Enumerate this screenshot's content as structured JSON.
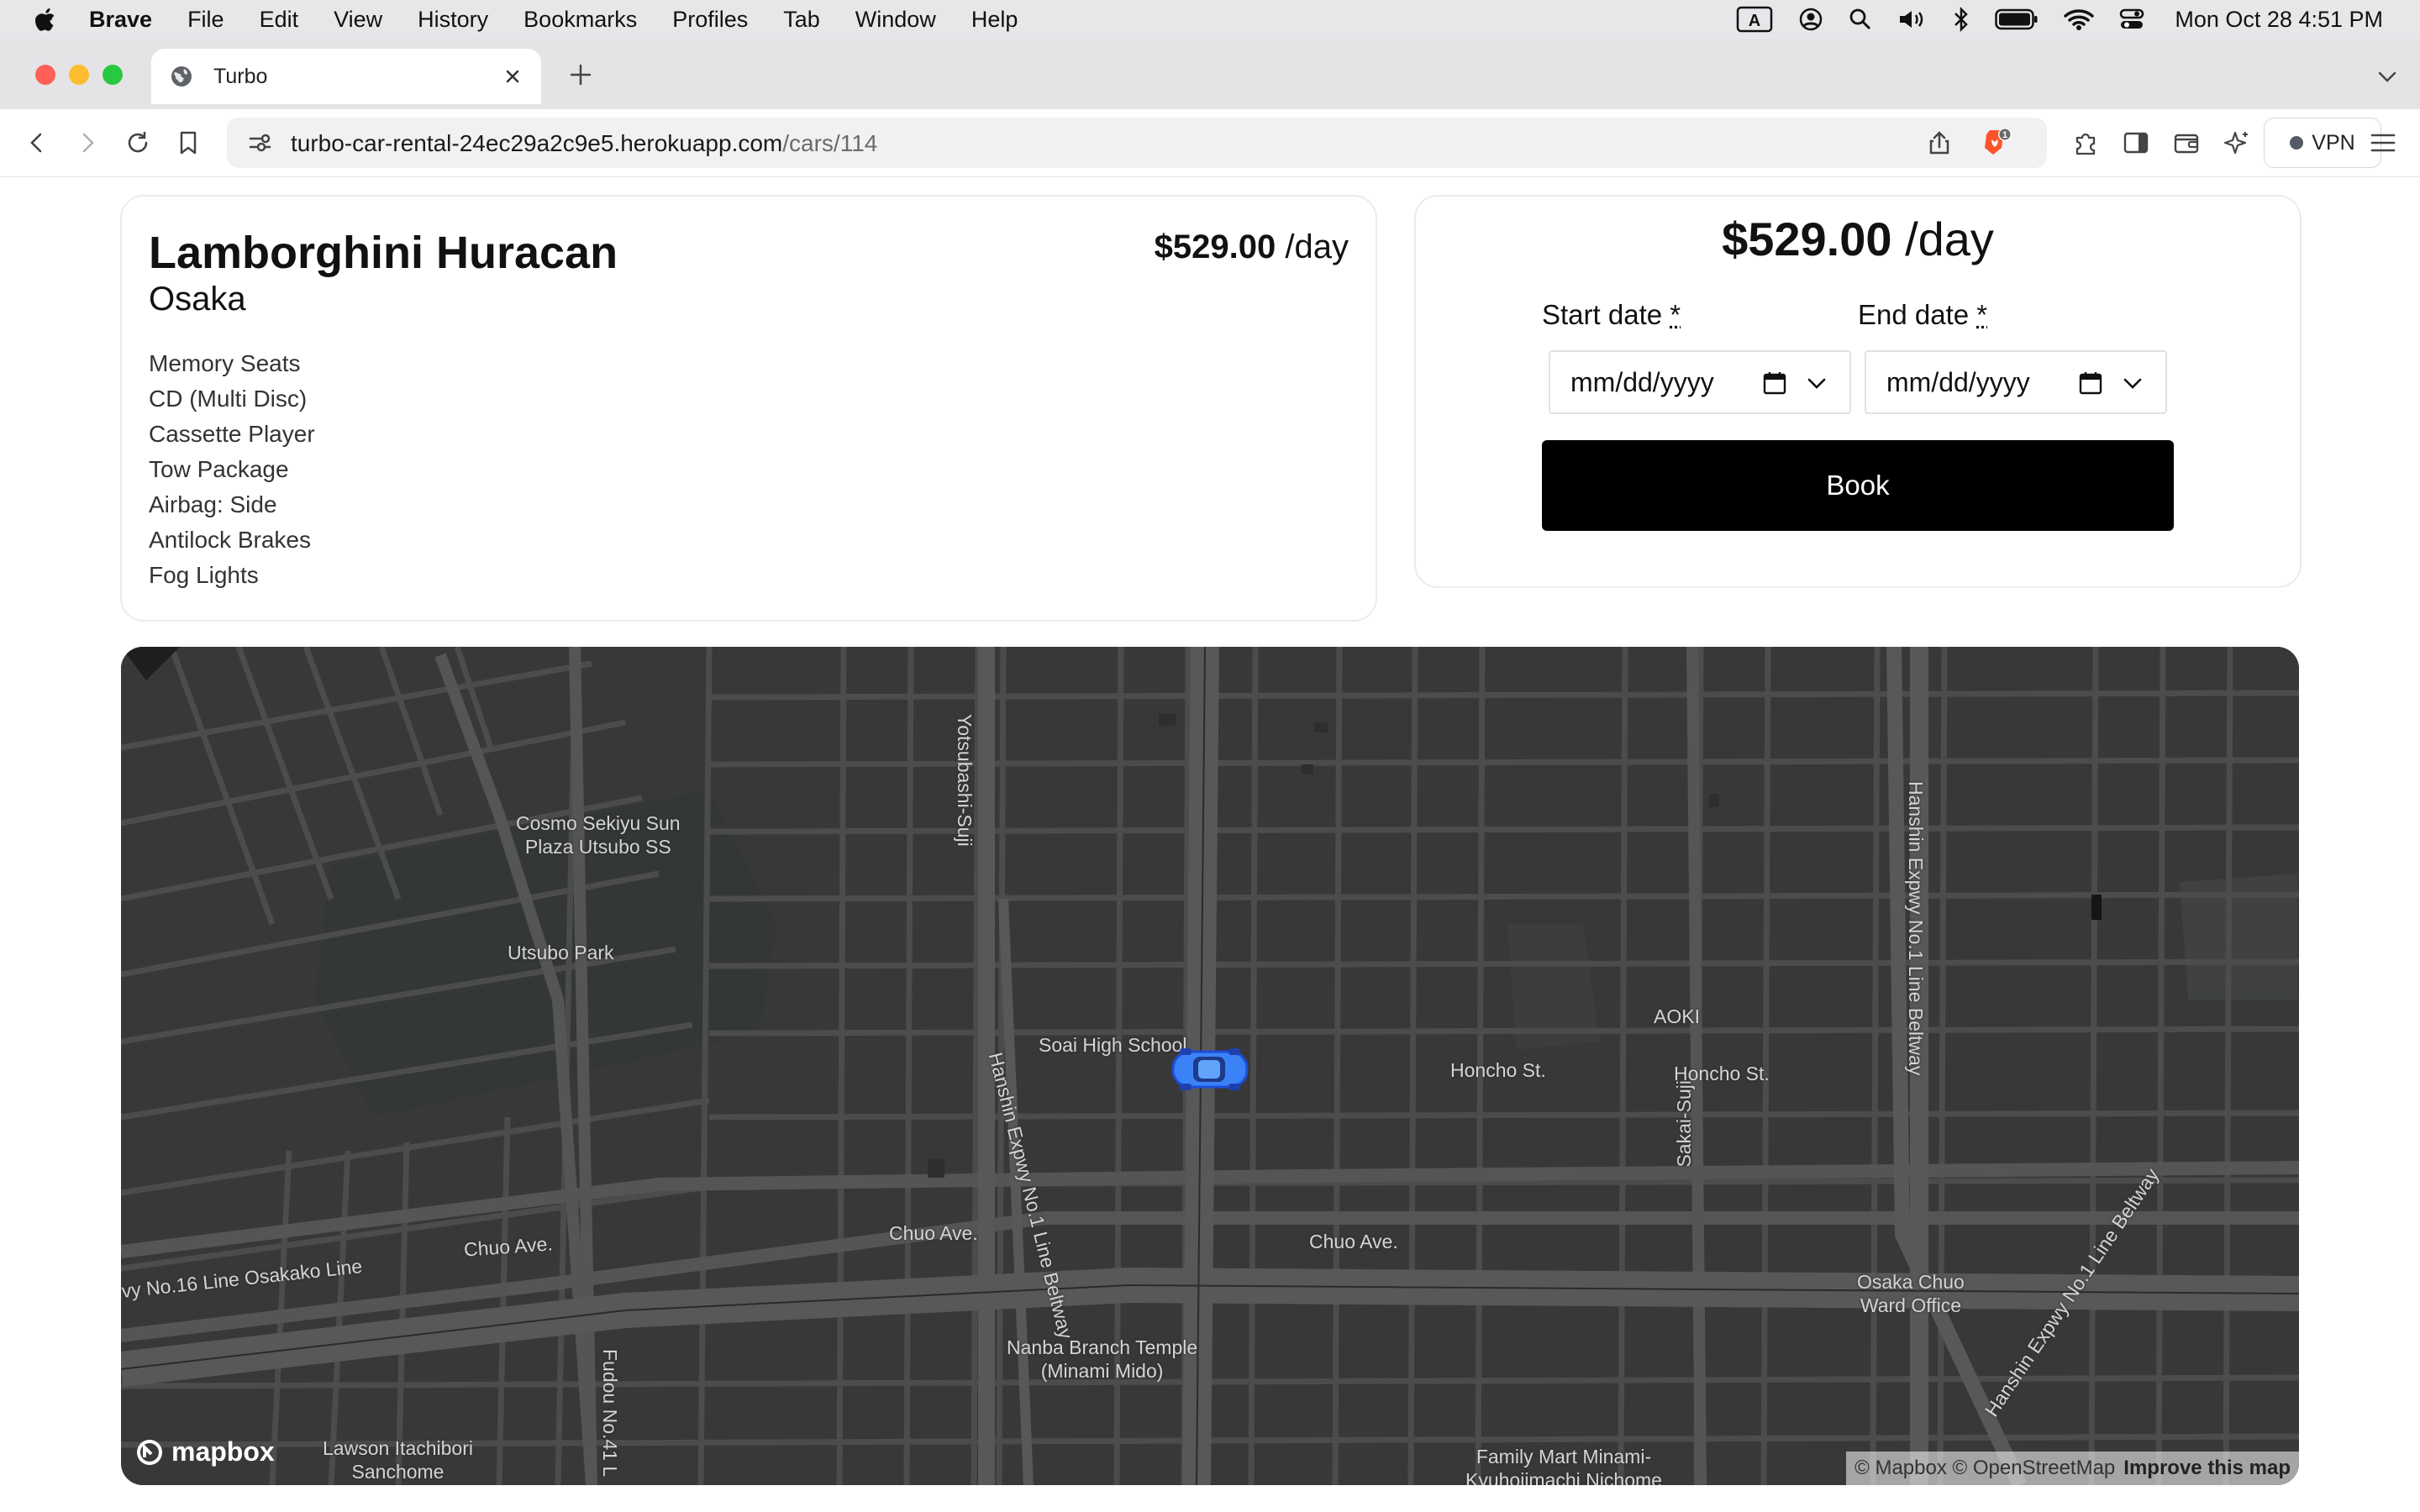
{
  "menubar": {
    "app_name": "Brave",
    "items": [
      "File",
      "Edit",
      "View",
      "History",
      "Bookmarks",
      "Profiles",
      "Tab",
      "Window",
      "Help"
    ],
    "input_source": "A",
    "clock": "Mon Oct 28  4:51 PM"
  },
  "browser": {
    "tab_title": "Turbo",
    "url_host": "turbo-car-rental-24ec29a2c9e5.herokuapp.com",
    "url_path": "/cars/114",
    "shield_count": "1",
    "vpn_label": "VPN",
    "colors": {
      "close": "#fe5f57",
      "minimize": "#febc2e",
      "zoom": "#28c840",
      "brave_orange": "#fb542b"
    }
  },
  "car": {
    "name": "Lamborghini Huracan",
    "city": "Osaka",
    "price": "$529.00",
    "per_day": "/day",
    "features": [
      "Memory Seats",
      "CD (Multi Disc)",
      "Cassette Player",
      "Tow Package",
      "Airbag: Side",
      "Antilock Brakes",
      "Fog Lights"
    ]
  },
  "booking": {
    "price": "$529.00",
    "per_day": "/day",
    "start_label": "Start date",
    "end_label": "End date",
    "required_mark": "*",
    "date_placeholder": "mm/dd/yyyy",
    "book_label": "Book"
  },
  "map": {
    "labels": {
      "cosmo": "Cosmo Sekiyu Sun\nPlaza Utsubo SS",
      "utsubo_park": "Utsubo Park",
      "yotsubashi": "Yotsubashi-Suji",
      "soai": "Soai High School",
      "hanshin_left": "Hanshin Expwy No.1 Line Beltway",
      "honcho1": "Honcho St.",
      "honcho2": "Honcho St.",
      "aoki": "AOKI",
      "sakai": "Sakai-Suji",
      "hanshin_right": "Hanshin Expwy No.1 Line Beltway",
      "chuo1": "Chuo Ave.",
      "chuo2": "Chuo Ave.",
      "chuo3": "Chuo Ave.",
      "osakako": "vy No.16 Line Osakako Line",
      "osaka_chuo": "Osaka Chuo\nWard Office",
      "hanshin_lower": "Hanshin Expwy No.1 Line Beltway",
      "nanba": "Nanba Branch Temple\n(Minami Mido)",
      "fudou": "Fudou No.41 L",
      "lawson": "Lawson Itachibori\nSanchome",
      "family_mart": "Family Mart Minami-\nKyuhojimachi Nichome"
    },
    "logo_text": "mapbox",
    "attribution": "© Mapbox © OpenStreetMap",
    "improve": "Improve this map",
    "marker_color": "#3b82f6"
  }
}
